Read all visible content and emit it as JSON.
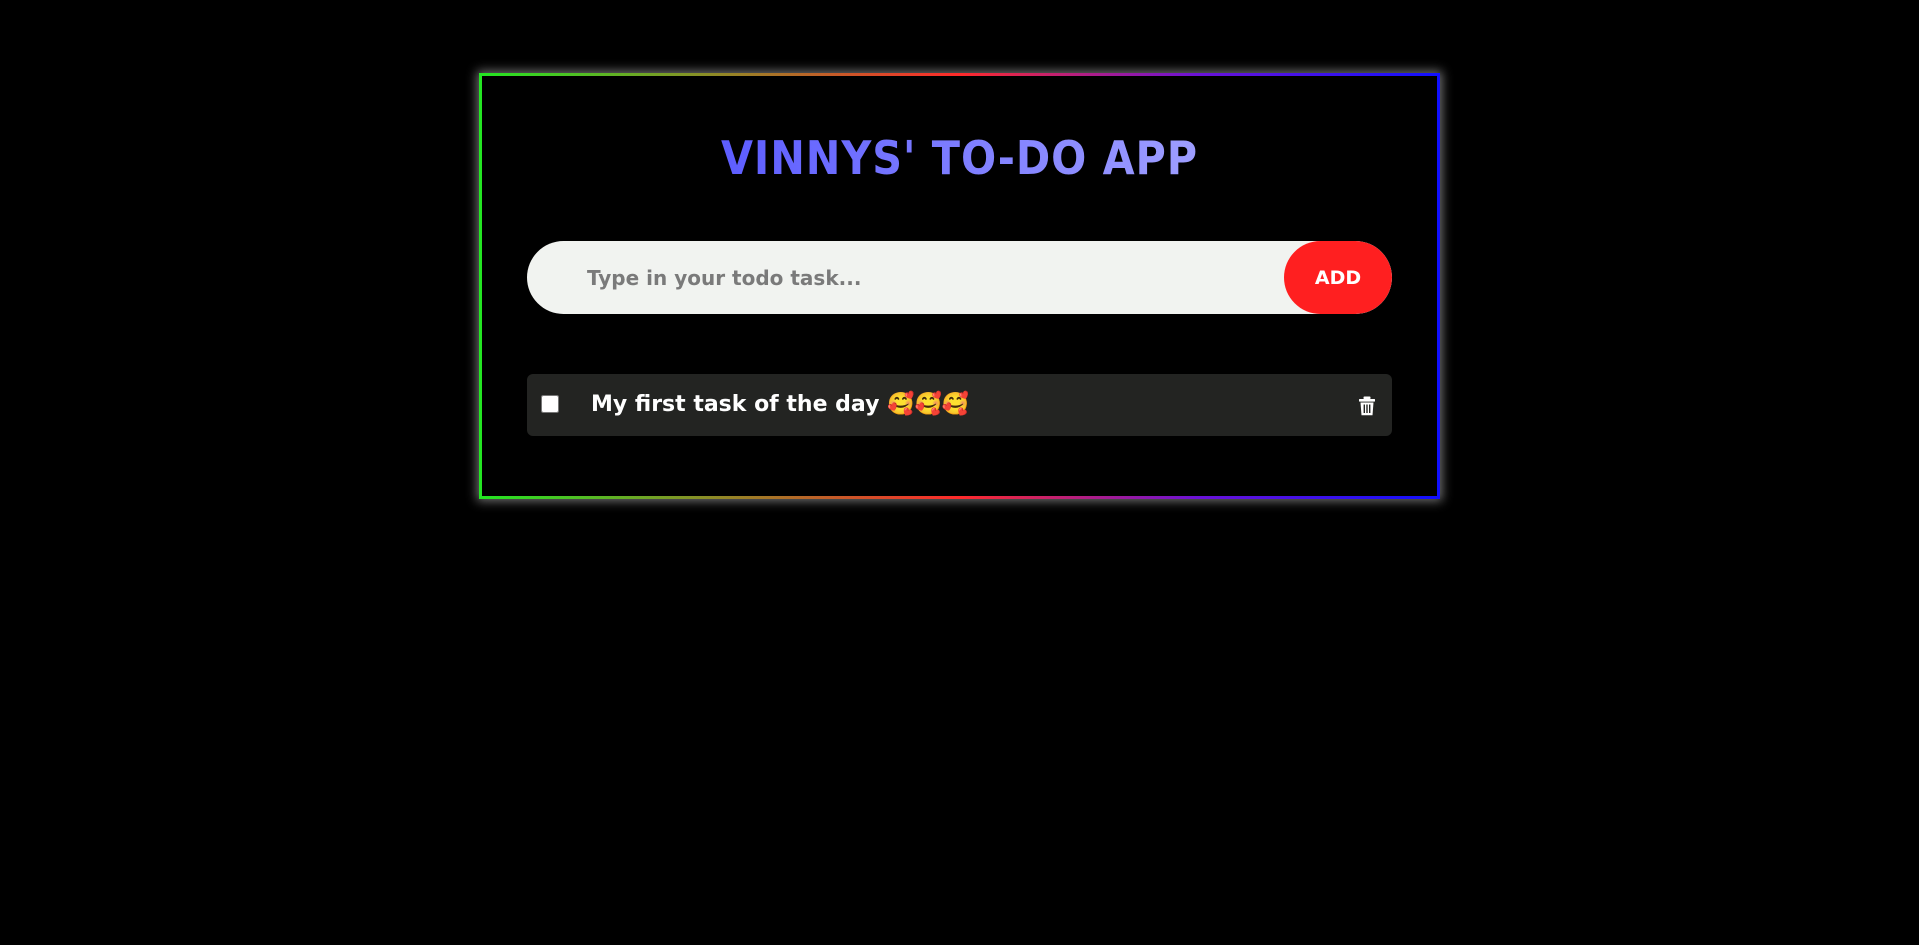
{
  "app": {
    "title": "VINNYS' TO-DO APP",
    "colors": {
      "background": "#000000",
      "title_gradient_start": "#4343ff",
      "title_gradient_end": "#b8b8ff",
      "add_button": "#ff1f20",
      "input_background": "#f1f3f0",
      "task_background": "#232422",
      "border_gradient": [
        "#22e622",
        "#ff2a2a",
        "#6a12d8",
        "#1010ff"
      ]
    }
  },
  "form": {
    "input_value": "",
    "input_placeholder": "Type in your todo task...",
    "add_label": "ADD"
  },
  "tasks": [
    {
      "text": "My first task of the day 🥰🥰🥰",
      "checked": false,
      "delete_icon": "trash-icon"
    }
  ]
}
